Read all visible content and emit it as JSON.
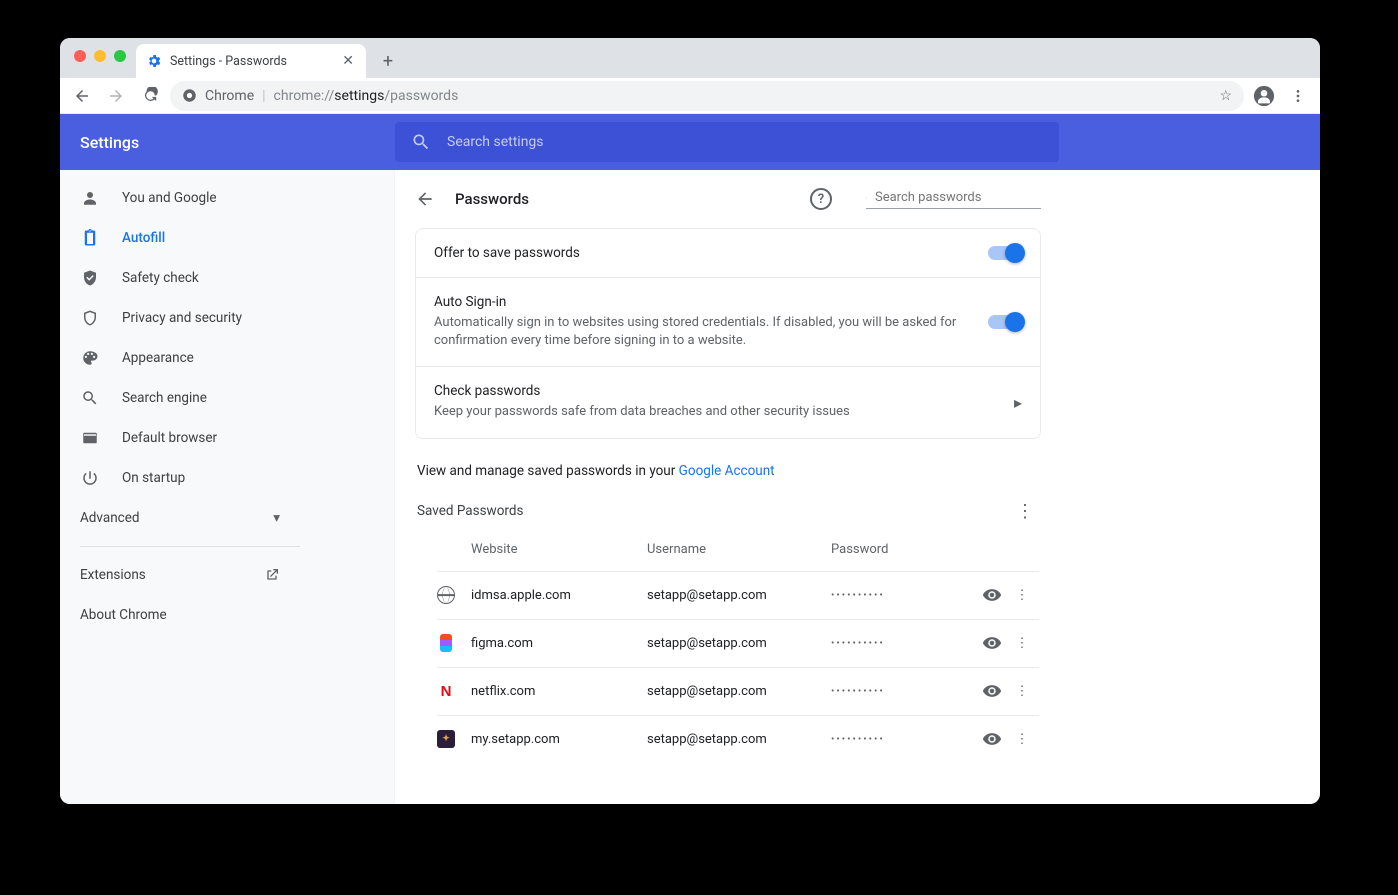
{
  "browser": {
    "tab_title": "Settings - Passwords",
    "omnibox": {
      "scheme_label": "Chrome",
      "url_muted1": "chrome://",
      "url_bold": "settings",
      "url_muted2": "/passwords"
    }
  },
  "header": {
    "title": "Settings",
    "search_placeholder": "Search settings"
  },
  "sidebar": {
    "items": [
      {
        "label": "You and Google"
      },
      {
        "label": "Autofill"
      },
      {
        "label": "Safety check"
      },
      {
        "label": "Privacy and security"
      },
      {
        "label": "Appearance"
      },
      {
        "label": "Search engine"
      },
      {
        "label": "Default browser"
      },
      {
        "label": "On startup"
      }
    ],
    "advanced": "Advanced",
    "extensions": "Extensions",
    "about": "About Chrome"
  },
  "page": {
    "title": "Passwords",
    "search_placeholder": "Search passwords",
    "offer_save": "Offer to save passwords",
    "auto_signin_title": "Auto Sign-in",
    "auto_signin_desc": "Automatically sign in to websites using stored credentials. If disabled, you will be asked for confirmation every time before signing in to a website.",
    "check_title": "Check passwords",
    "check_desc": "Keep your passwords safe from data breaches and other security issues",
    "gacct_text": "View and manage saved passwords in your ",
    "gacct_link": "Google Account",
    "saved_title": "Saved Passwords",
    "columns": {
      "website": "Website",
      "username": "Username",
      "password": "Password"
    },
    "rows": [
      {
        "site": "idmsa.apple.com",
        "user": "setapp@setapp.com",
        "mask": "••••••••••"
      },
      {
        "site": "figma.com",
        "user": "setapp@setapp.com",
        "mask": "••••••••••"
      },
      {
        "site": "netflix.com",
        "user": "setapp@setapp.com",
        "mask": "••••••••••"
      },
      {
        "site": "my.setapp.com",
        "user": "setapp@setapp.com",
        "mask": "••••••••••"
      }
    ]
  }
}
